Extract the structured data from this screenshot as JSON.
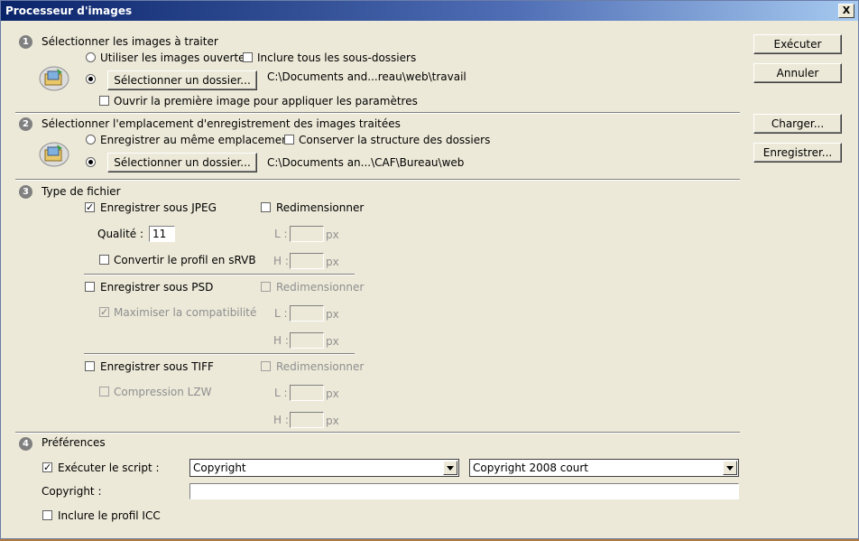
{
  "window": {
    "title": "Processeur d'images",
    "close_label": "X"
  },
  "buttons": {
    "execute": "Exécuter",
    "cancel": "Annuler",
    "load": "Charger...",
    "save": "Enregistrer..."
  },
  "section1": {
    "number": "1",
    "title": "Sélectionner les images à traiter",
    "use_open_images": "Utiliser les images ouvertes",
    "include_subfolders": "Inclure tous les sous-dossiers",
    "select_folder_button": "Sélectionner un dossier...",
    "folder_path": "C:\\Documents and...reau\\web\\travail",
    "open_first_image": "Ouvrir la première image pour appliquer les paramètres"
  },
  "section2": {
    "number": "2",
    "title": "Sélectionner l'emplacement d'enregistrement des images traitées",
    "save_same_location": "Enregistrer au même emplacement",
    "keep_folder_structure": "Conserver la structure des dossiers",
    "select_folder_button": "Sélectionner un dossier...",
    "folder_path": "C:\\Documents an...\\CAF\\Bureau\\web"
  },
  "section3": {
    "number": "3",
    "title": "Type de fichier",
    "jpeg": {
      "label": "Enregistrer sous JPEG",
      "checked": true,
      "resize": "Redimensionner",
      "quality_label": "Qualité :",
      "quality_value": "11",
      "convert_srgb": "Convertir le profil en sRVB"
    },
    "psd": {
      "label": "Enregistrer sous PSD",
      "resize": "Redimensionner",
      "maximize": "Maximiser la compatibilité"
    },
    "tiff": {
      "label": "Enregistrer sous TIFF",
      "resize": "Redimensionner",
      "lzw": "Compression LZW"
    },
    "width_label": "L :",
    "height_label": "H :",
    "unit": "px"
  },
  "section4": {
    "number": "4",
    "title": "Préférences",
    "run_script": "Exécuter le script :",
    "script_set": "Copyright",
    "script_action": "Copyright 2008 court",
    "copyright_label": "Copyright :",
    "copyright_value": "",
    "include_icc": "Inclure le profil ICC"
  }
}
